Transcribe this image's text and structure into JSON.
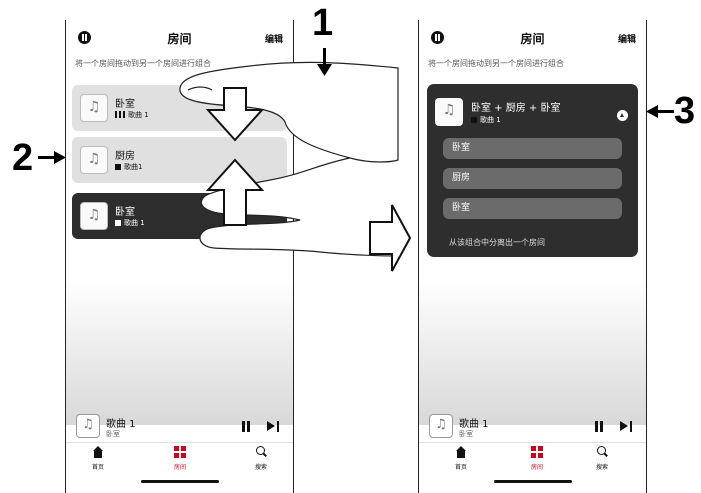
{
  "left_phone": {
    "header": {
      "title": "房间",
      "edit_label": "编辑"
    },
    "hint": "将一个房间拖动到另一个房间进行组合",
    "rooms": [
      {
        "name": "卧室",
        "track": "歌曲 1",
        "status_icon": "equalizer-bars-icon"
      },
      {
        "name": "厨房",
        "track": "歌曲1",
        "status_icon": "stopped-square-icon"
      },
      {
        "name": "卧室",
        "track": "歌曲 1",
        "status_icon": "stopped-square-icon"
      }
    ],
    "now_playing": {
      "title": "歌曲 1",
      "room": "卧室"
    },
    "tabs": [
      {
        "label": "首页"
      },
      {
        "label": "房间"
      },
      {
        "label": "搜索"
      }
    ]
  },
  "right_phone": {
    "header": {
      "title": "房间",
      "edit_label": "编辑"
    },
    "hint": "将一个房间拖动到另一个房间进行组合",
    "group": {
      "title": "卧室 + 厨房 + 卧室",
      "track": "歌曲 1",
      "members": [
        "卧室",
        "厨房",
        "卧室"
      ],
      "footer": "从该组合中分离出一个房间"
    },
    "now_playing": {
      "title": "歌曲 1",
      "room": "卧室"
    },
    "tabs": [
      {
        "label": "首页"
      },
      {
        "label": "房间"
      },
      {
        "label": "搜索"
      }
    ]
  },
  "callouts": {
    "one": "1",
    "two": "2",
    "three": "3"
  },
  "colors": {
    "accent": "#d0021b",
    "dark_card": "#2d2d2d"
  }
}
